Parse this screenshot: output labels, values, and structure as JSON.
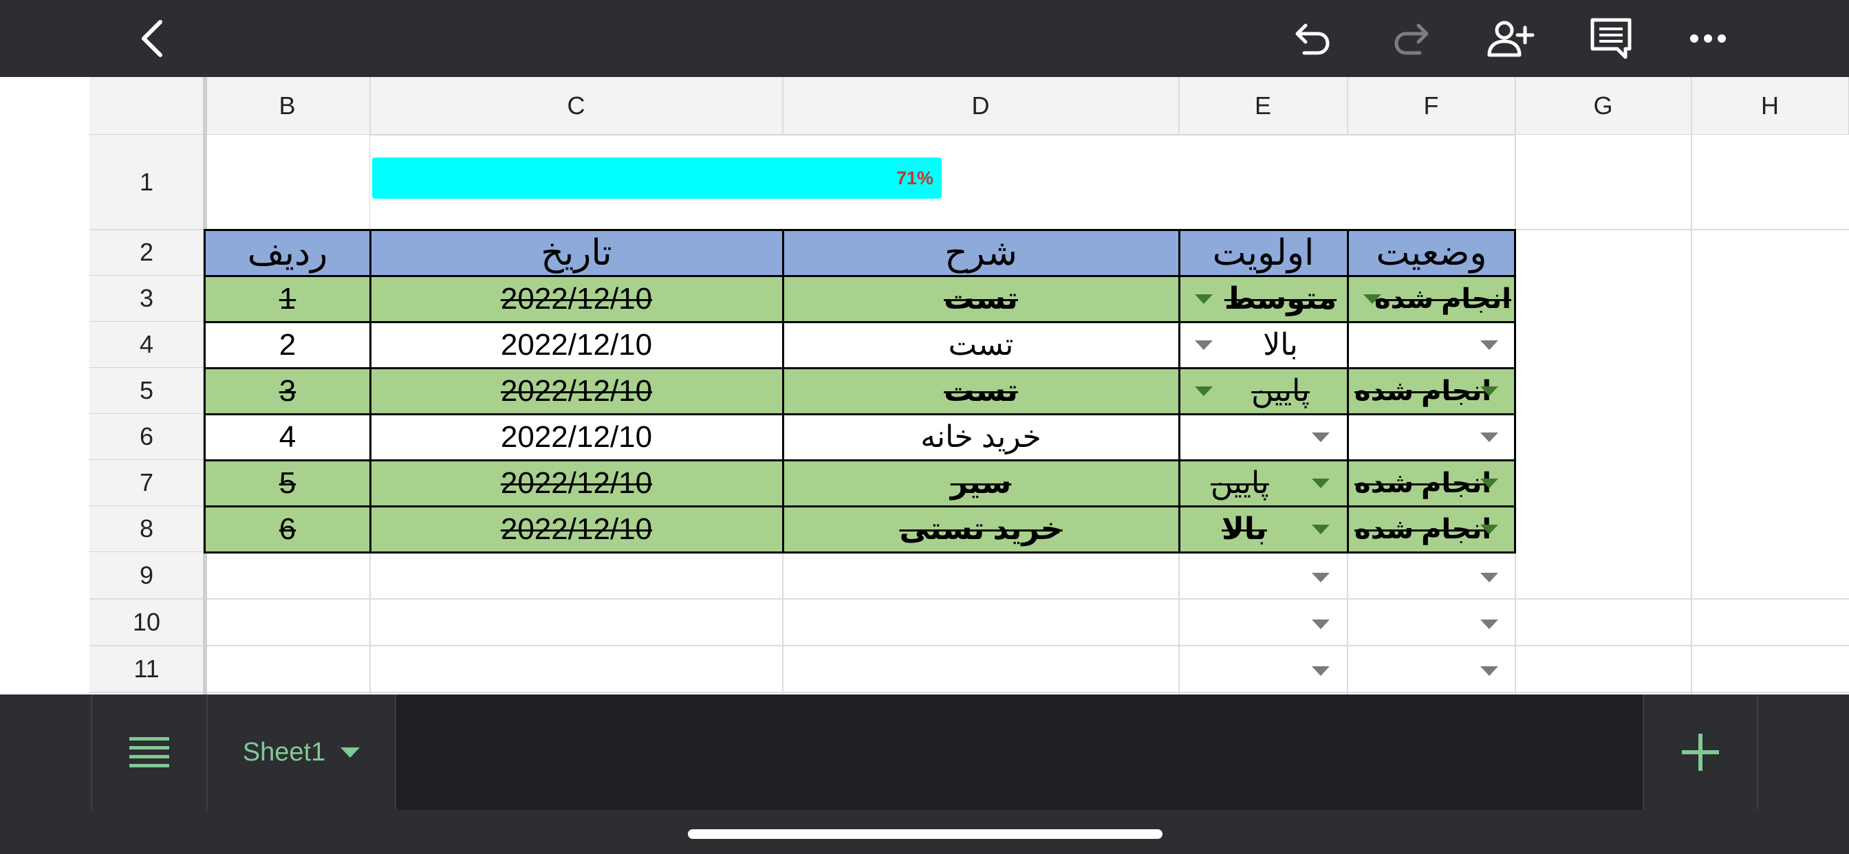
{
  "toolbar": {
    "back": "back-icon",
    "undo": "undo-icon",
    "redo": "redo-icon",
    "share": "add-person-icon",
    "comment": "comment-icon",
    "more": "more-icon"
  },
  "columns": [
    "B",
    "C",
    "D",
    "E",
    "F",
    "G",
    "H"
  ],
  "rows": [
    "1",
    "2",
    "3",
    "4",
    "5",
    "6",
    "7",
    "8",
    "9",
    "10",
    "11"
  ],
  "progress": {
    "value": 0.71,
    "label": "71%",
    "color": "#00ffff",
    "label_color": "#c0392b"
  },
  "table": {
    "headers": [
      "ردیف",
      "تاریخ",
      "شرح",
      "اولویت",
      "وضعیت"
    ],
    "header_color": "#8eaadb",
    "done_color": "#a9d18e",
    "rows": [
      {
        "num": "1",
        "date": "2022/12/10",
        "desc": "تست",
        "priority": "متوسط",
        "status": "انجام شده",
        "done": true
      },
      {
        "num": "2",
        "date": "2022/12/10",
        "desc": "تست",
        "priority": "بالا",
        "status": "",
        "done": false
      },
      {
        "num": "3",
        "date": "2022/12/10",
        "desc": "تست",
        "priority": "پایین",
        "status": "انجام شده",
        "done": true
      },
      {
        "num": "4",
        "date": "2022/12/10",
        "desc": "خرید خانه",
        "priority": "",
        "status": "",
        "done": false
      },
      {
        "num": "5",
        "date": "2022/12/10",
        "desc": "سیر",
        "priority": "پایین",
        "status": "انجام شده",
        "done": true
      },
      {
        "num": "6",
        "date": "2022/12/10",
        "desc": "خرید تستی",
        "priority": "بالا",
        "status": "انجام شده",
        "done": true
      }
    ]
  },
  "bottom": {
    "sheet_tab": "Sheet1",
    "accent": "#81c995",
    "menu": "list-icon",
    "add": "plus-icon"
  }
}
